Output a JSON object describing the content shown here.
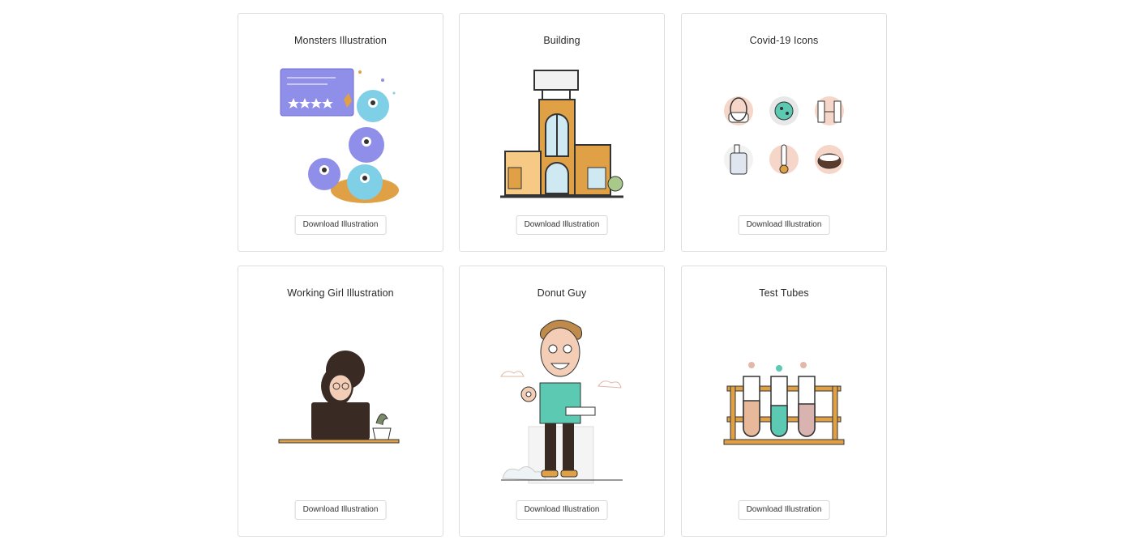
{
  "cards": [
    {
      "title": "Monsters Illustration",
      "button": "Download Illustration",
      "icon": "monsters-illustration"
    },
    {
      "title": "Building",
      "button": "Download Illustration",
      "icon": "building-illustration"
    },
    {
      "title": "Covid-19 Icons",
      "button": "Download Illustration",
      "icon": "covid-icons-illustration"
    },
    {
      "title": "Working Girl Illustration",
      "button": "Download Illustration",
      "icon": "working-girl-illustration"
    },
    {
      "title": "Donut Guy",
      "button": "Download Illustration",
      "icon": "donut-guy-illustration"
    },
    {
      "title": "Test Tubes",
      "button": "Download Illustration",
      "icon": "test-tubes-illustration"
    }
  ],
  "colors": {
    "border": "#dedede",
    "brand_orange": "#e0a046",
    "purple": "#8f8ee8",
    "teal": "#5cc9b2"
  }
}
